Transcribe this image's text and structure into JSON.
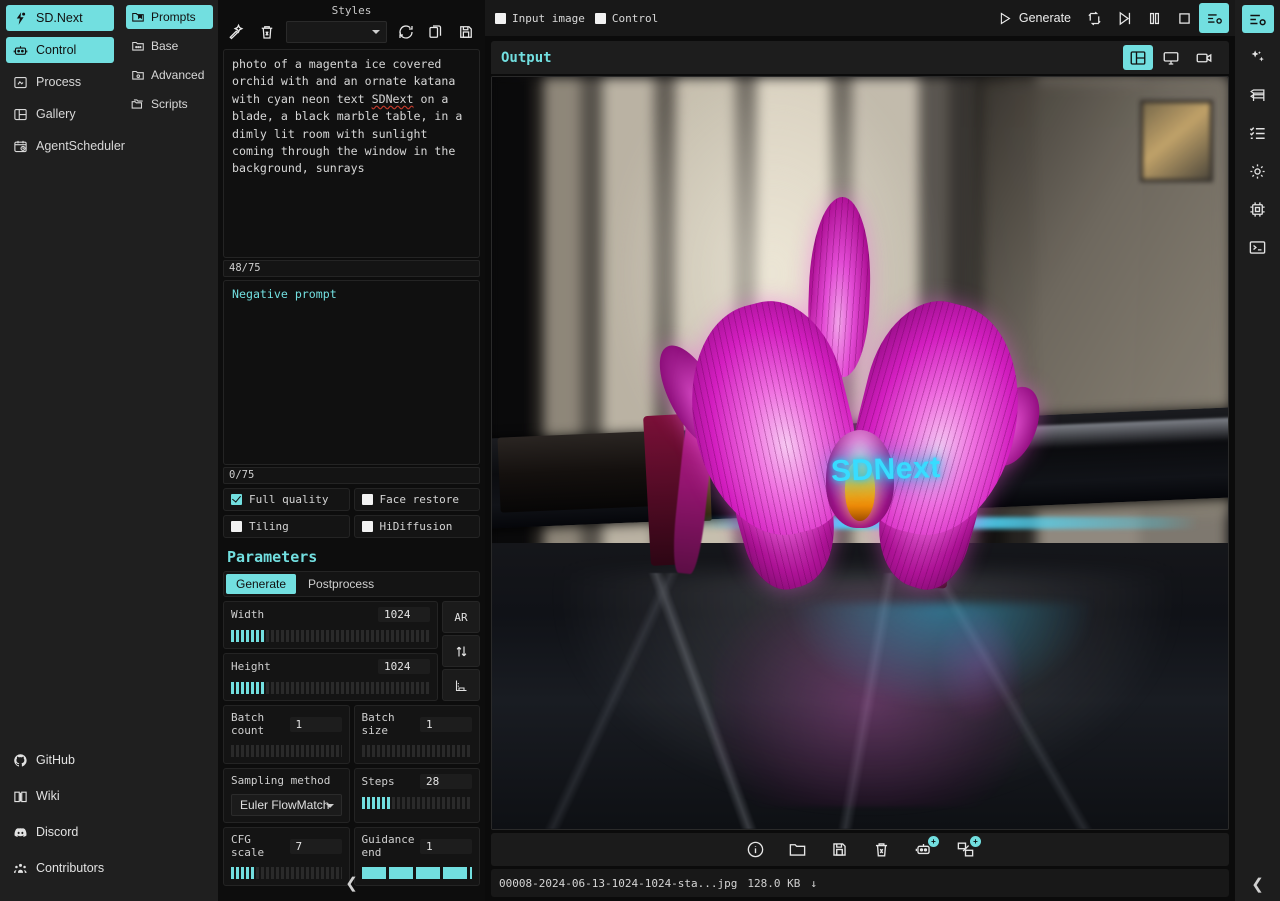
{
  "left_nav": {
    "brand": {
      "label": "SD.Next",
      "icon": "sdnext-logo-icon"
    },
    "items": [
      {
        "label": "Control",
        "icon": "robot-icon",
        "active": true
      },
      {
        "label": "Process",
        "icon": "process-icon",
        "active": false
      },
      {
        "label": "Gallery",
        "icon": "gallery-icon",
        "active": false
      },
      {
        "label": "AgentScheduler",
        "icon": "calendar-clock-icon",
        "active": false
      }
    ],
    "bottom_items": [
      {
        "label": "GitHub",
        "icon": "github-icon"
      },
      {
        "label": "Wiki",
        "icon": "book-icon"
      },
      {
        "label": "Discord",
        "icon": "discord-icon"
      },
      {
        "label": "Contributors",
        "icon": "people-icon"
      }
    ],
    "collapse_icon": "chevron-left-icon"
  },
  "sub_nav": {
    "items": [
      {
        "label": "Prompts",
        "icon": "folder-bookmark-icon",
        "active": true
      },
      {
        "label": "Base",
        "icon": "folder-dots-icon",
        "active": false
      },
      {
        "label": "Advanced",
        "icon": "folder-gear-icon",
        "active": false
      },
      {
        "label": "Scripts",
        "icon": "folder-stack-icon",
        "active": false
      }
    ]
  },
  "prompt_panel": {
    "styles_label": "Styles",
    "styles_value": "",
    "toolbar": [
      {
        "name": "magic-wand-icon",
        "title": "Apply style"
      },
      {
        "name": "trash-icon",
        "title": "Clear style"
      },
      {
        "name": "refresh-icon",
        "title": "Refresh"
      },
      {
        "name": "copy-icon",
        "title": "Copy"
      },
      {
        "name": "save-icon",
        "title": "Save"
      }
    ],
    "prompt_text_pre": "photo of a magenta ice covered orchid with and an ornate katana with cyan neon text ",
    "prompt_text_highlight": "SDNext",
    "prompt_text_post": " on a blade, a black marble table, in a dimly lit room with sunlight coming through the window in the background, sunrays",
    "prompt_counter": "48/75",
    "negative_placeholder": "Negative prompt",
    "negative_value": "",
    "negative_counter": "0/75",
    "checkboxes": [
      {
        "label": "Full quality",
        "checked": true
      },
      {
        "label": "Face restore",
        "checked": false
      },
      {
        "label": "Tiling",
        "checked": false
      },
      {
        "label": "HiDiffusion",
        "checked": false
      }
    ]
  },
  "parameters": {
    "heading": "Parameters",
    "tabs": [
      {
        "label": "Generate",
        "active": true
      },
      {
        "label": "Postprocess",
        "active": false
      }
    ],
    "sliders": [
      {
        "label": "Width",
        "value": "1024",
        "fill_pct": 17
      },
      {
        "label": "Height",
        "value": "1024",
        "fill_pct": 17
      },
      {
        "label": "Batch count",
        "value": "1",
        "fill_pct": 0
      },
      {
        "label": "Batch size",
        "value": "1",
        "fill_pct": 0
      },
      {
        "label": "Steps",
        "value": "28",
        "fill_pct": 28
      },
      {
        "label": "CFG scale",
        "value": "7",
        "fill_pct": 23
      },
      {
        "label": "Guidance end",
        "value": "1",
        "fill_pct": 100
      }
    ],
    "sampling": {
      "label": "Sampling method",
      "value": "Euler FlowMatch"
    },
    "side_buttons": [
      {
        "label": "AR",
        "icon": "aspect-ratio-button"
      },
      {
        "label": "",
        "icon": "swap-arrows-icon"
      },
      {
        "label": "",
        "icon": "ruler-icon"
      }
    ]
  },
  "topbar": {
    "checkboxes": [
      {
        "label": "Input image",
        "checked": false
      },
      {
        "label": "Control",
        "checked": false
      }
    ],
    "generate_label": "Generate",
    "icons": [
      {
        "name": "play-icon"
      },
      {
        "name": "reprocess-icon"
      },
      {
        "name": "skip-icon"
      },
      {
        "name": "pause-icon"
      },
      {
        "name": "stop-icon"
      },
      {
        "name": "settings-sliders-icon",
        "active": true
      }
    ]
  },
  "output": {
    "title": "Output",
    "view_icons": [
      {
        "name": "gallery-view-icon",
        "active": true
      },
      {
        "name": "monitor-view-icon",
        "active": false
      },
      {
        "name": "video-view-icon",
        "active": false
      }
    ],
    "image_tools": [
      {
        "name": "info-icon",
        "badge": ""
      },
      {
        "name": "folder-icon",
        "badge": ""
      },
      {
        "name": "save-icon",
        "badge": ""
      },
      {
        "name": "delete-icon",
        "badge": ""
      },
      {
        "name": "send-to-control-icon",
        "badge": "+"
      },
      {
        "name": "send-to-process-icon",
        "badge": "+"
      }
    ],
    "file_name": "00008-2024-06-13-1024-1024-sta...jpg",
    "file_size": "128.0 KB",
    "download_icon": "download-arrow-icon",
    "image_alt_text": "SDNext"
  },
  "right_rail": {
    "icons": [
      {
        "name": "settings-sliders-icon",
        "active": true
      },
      {
        "name": "sparkles-icon",
        "active": false
      },
      {
        "name": "models-server-icon",
        "active": false
      },
      {
        "name": "checklist-icon",
        "active": false
      },
      {
        "name": "gear-icon",
        "active": false
      },
      {
        "name": "chip-icon",
        "active": false
      },
      {
        "name": "terminal-icon",
        "active": false
      }
    ],
    "collapse_icon": "chevron-left-icon"
  },
  "theme": {
    "accent": "#72dfe0",
    "bg": "#0b0b0b",
    "panel": "#1f1f1f",
    "neon_text_color": "#38dcff",
    "flower_color": "#d31ec0"
  }
}
